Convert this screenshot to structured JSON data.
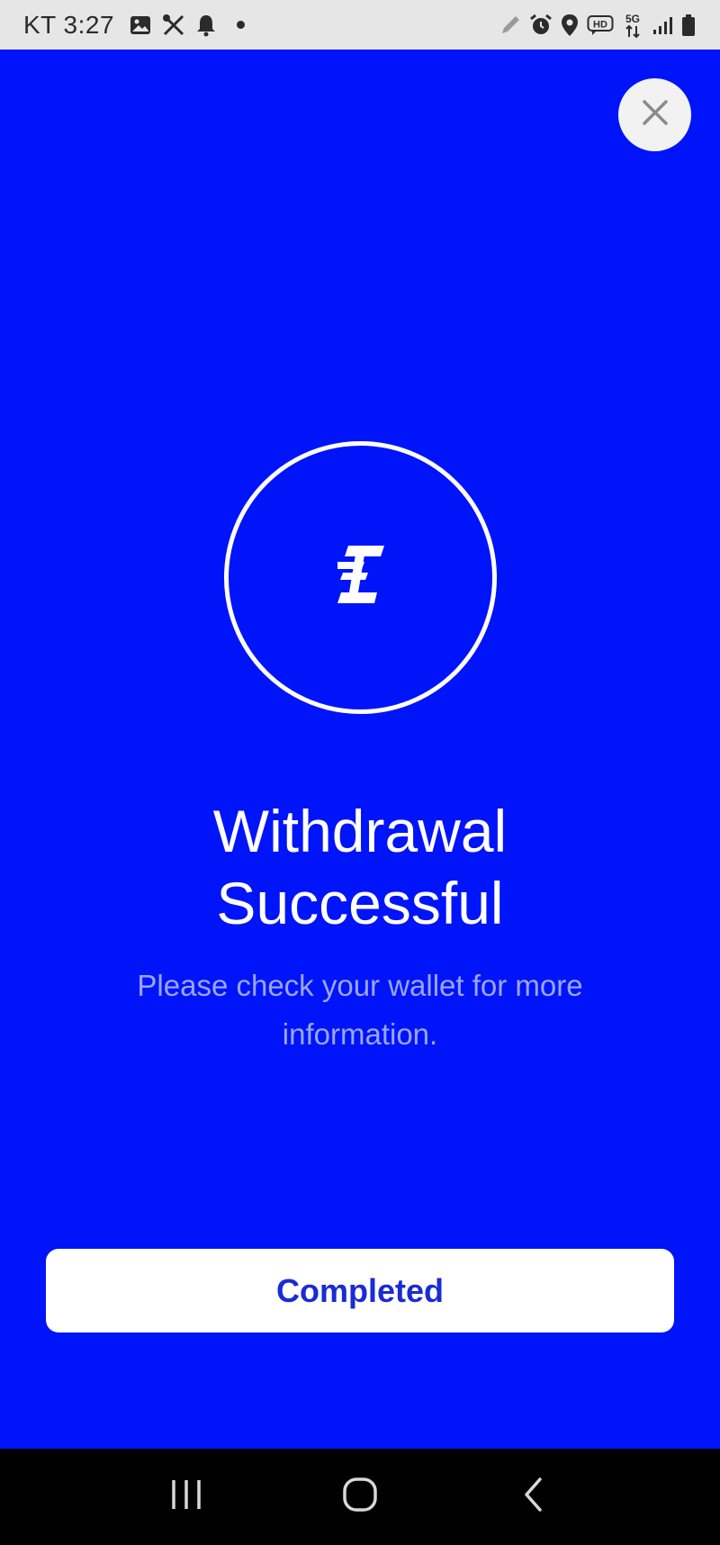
{
  "status_bar": {
    "carrier_time": "KT 3:27",
    "left_icons": [
      "image-icon",
      "tools-icon",
      "bell-icon",
      "dot-icon"
    ],
    "right_icons": [
      "pencil-icon",
      "alarm-icon",
      "location-icon",
      "hd-icon",
      "5g-icon",
      "signal-icon",
      "battery-icon"
    ],
    "hd_label": "HD",
    "net_label": "5G"
  },
  "screen": {
    "background_color": "#0014fa",
    "close_icon": "close-icon",
    "logo_icon": "exchange-logo-icon",
    "title_line1": "Withdrawal",
    "title_line2": "Successful",
    "subtitle": "Please check your wallet for more information.",
    "completed_label": "Completed"
  },
  "nav_bar": {
    "icons": [
      "recent-apps-icon",
      "home-icon",
      "back-icon"
    ]
  }
}
